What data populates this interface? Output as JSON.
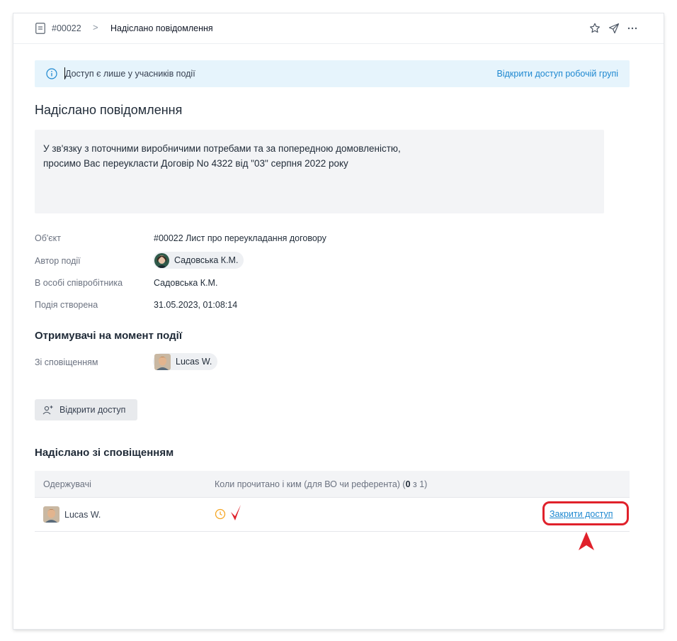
{
  "header": {
    "doc_id": "#00022",
    "separator": ">",
    "title": "Надіслано повідомлення"
  },
  "banner": {
    "text": "Доступ є лише у учасників події",
    "link": "Відкрити доступ робочій групі"
  },
  "event": {
    "title": "Надіслано повідомлення",
    "message_line1": "У зв'язку з поточними виробничими потребами та за попередною домовленістю,",
    "message_line2": "просимо Вас переукласти Договір No 4322 від \"03\" серпня 2022 року"
  },
  "properties": {
    "object_label": "Об'єкт",
    "object_value": "#00022 Лист про переукладання договору",
    "author_label": "Автор події",
    "author_value": "Садовська К.М.",
    "employee_label": "В особі співробітника",
    "employee_value": "Садовська К.М.",
    "created_label": "Подія створена",
    "created_value": "31.05.2023, 01:08:14"
  },
  "recipients": {
    "title": "Отримувачі на момент події",
    "notified_label": "Зі сповіщенням",
    "notified_user": "Lucas W."
  },
  "open_access_button": "Відкрити доступ",
  "sent_section": {
    "title": "Надіслано зі сповіщенням",
    "col_recipients": "Одержувачі",
    "col_read_prefix": "Коли прочитано і ким (для ВО чи референта) (",
    "col_read_count": "0",
    "col_read_suffix": " з 1)",
    "rows": [
      {
        "user": "Lucas W.",
        "action": "Закрити доступ"
      }
    ]
  },
  "colors": {
    "link": "#1e88d0",
    "banner_bg": "#e6f4fc",
    "highlight": "#e0212b",
    "clock": "#f5a623"
  },
  "icons": [
    "document-icon",
    "chevron-right-icon",
    "star-icon",
    "send-icon",
    "more-icon",
    "info-icon",
    "add-user-icon",
    "clock-icon",
    "check-icon"
  ]
}
